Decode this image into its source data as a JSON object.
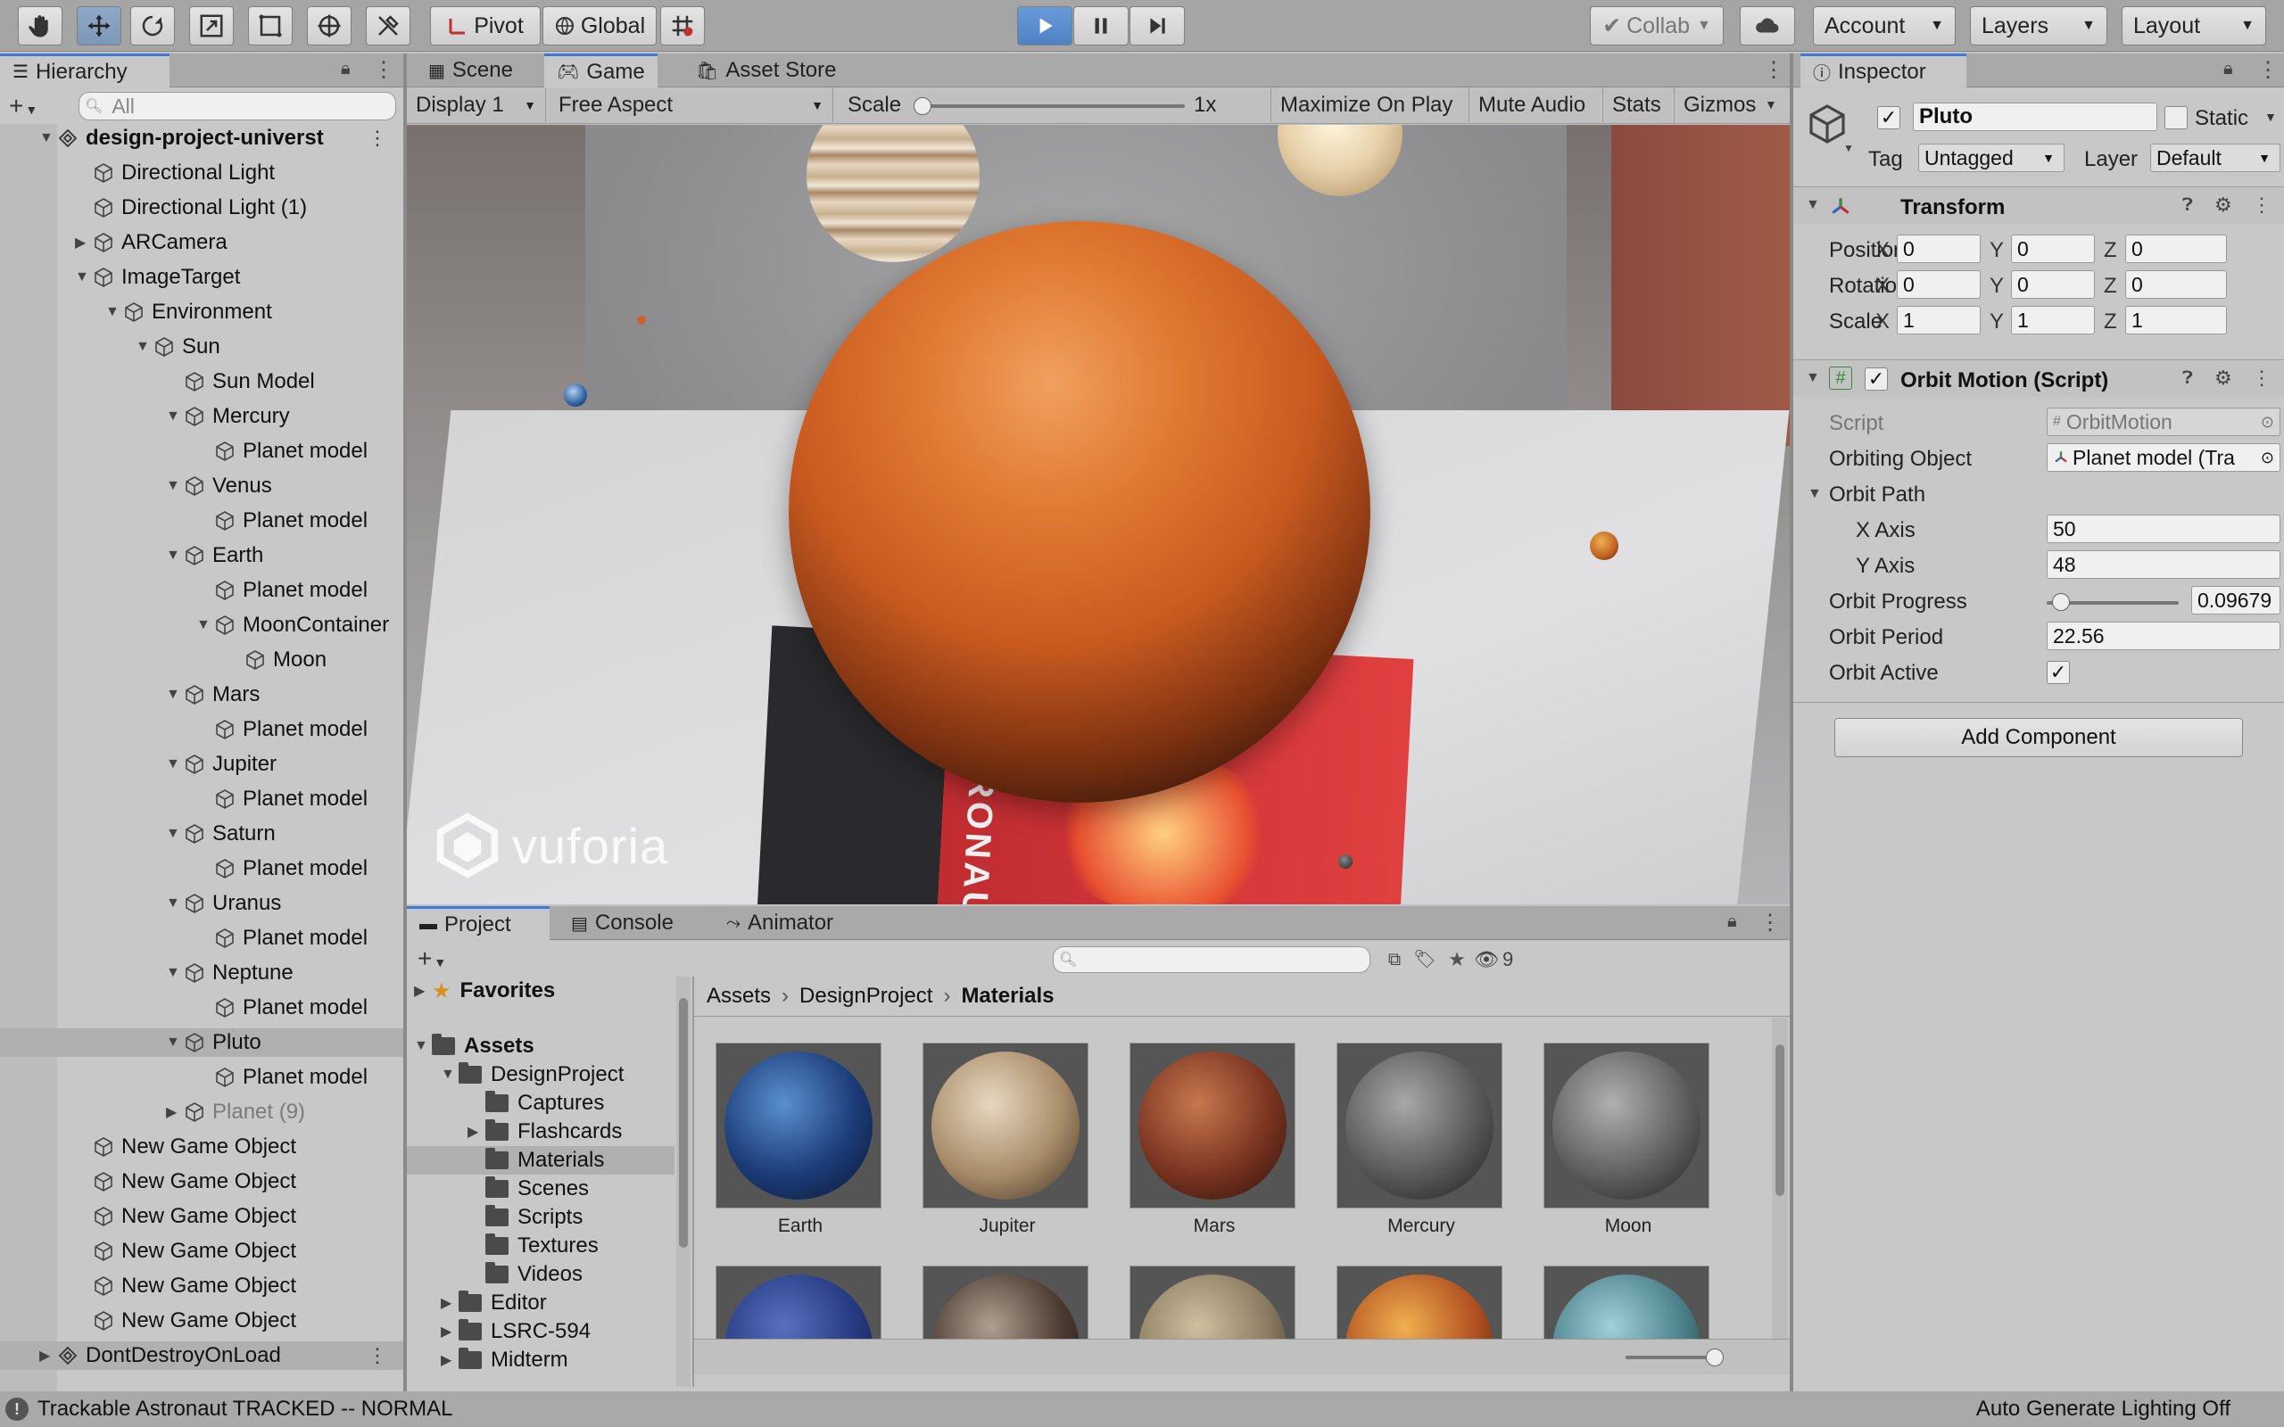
{
  "toolbar": {
    "pivot": "Pivot",
    "global": "Global",
    "collab": "Collab",
    "account": "Account",
    "layers": "Layers",
    "layout": "Layout"
  },
  "hierarchy": {
    "title": "Hierarchy",
    "search_placeholder": "All",
    "rows": [
      {
        "label": "design-project-universt",
        "depth": 0,
        "arrow": "open",
        "icon": "scene-icon",
        "bold": true
      },
      {
        "label": "Directional Light",
        "depth": 1,
        "arrow": "none",
        "icon": "cube-icon"
      },
      {
        "label": "Directional Light (1)",
        "depth": 1,
        "arrow": "none",
        "icon": "cube-icon"
      },
      {
        "label": "ARCamera",
        "depth": 1,
        "arrow": "closed",
        "icon": "cube-icon"
      },
      {
        "label": "ImageTarget",
        "depth": 1,
        "arrow": "open",
        "icon": "cube-icon"
      },
      {
        "label": "Environment",
        "depth": 2,
        "arrow": "open",
        "icon": "cube-icon"
      },
      {
        "label": "Sun",
        "depth": 3,
        "arrow": "open",
        "icon": "cube-icon"
      },
      {
        "label": "Sun Model",
        "depth": 4,
        "arrow": "none",
        "icon": "cube-icon"
      },
      {
        "label": "Mercury",
        "depth": 4,
        "arrow": "open",
        "icon": "cube-icon"
      },
      {
        "label": "Planet model",
        "depth": 5,
        "arrow": "none",
        "icon": "cube-icon"
      },
      {
        "label": "Venus",
        "depth": 4,
        "arrow": "open",
        "icon": "cube-icon"
      },
      {
        "label": "Planet model",
        "depth": 5,
        "arrow": "none",
        "icon": "cube-icon"
      },
      {
        "label": "Earth",
        "depth": 4,
        "arrow": "open",
        "icon": "cube-icon"
      },
      {
        "label": "Planet model",
        "depth": 5,
        "arrow": "none",
        "icon": "cube-icon"
      },
      {
        "label": "MoonContainer",
        "depth": 5,
        "arrow": "open",
        "icon": "cube-icon"
      },
      {
        "label": "Moon",
        "depth": 6,
        "arrow": "none",
        "icon": "cube-icon"
      },
      {
        "label": "Mars",
        "depth": 4,
        "arrow": "open",
        "icon": "cube-icon"
      },
      {
        "label": "Planet model",
        "depth": 5,
        "arrow": "none",
        "icon": "cube-icon"
      },
      {
        "label": "Jupiter",
        "depth": 4,
        "arrow": "open",
        "icon": "cube-icon"
      },
      {
        "label": "Planet model",
        "depth": 5,
        "arrow": "none",
        "icon": "cube-icon"
      },
      {
        "label": "Saturn",
        "depth": 4,
        "arrow": "open",
        "icon": "cube-icon"
      },
      {
        "label": "Planet model",
        "depth": 5,
        "arrow": "none",
        "icon": "cube-icon"
      },
      {
        "label": "Uranus",
        "depth": 4,
        "arrow": "open",
        "icon": "cube-icon"
      },
      {
        "label": "Planet model",
        "depth": 5,
        "arrow": "none",
        "icon": "cube-icon"
      },
      {
        "label": "Neptune",
        "depth": 4,
        "arrow": "open",
        "icon": "cube-icon"
      },
      {
        "label": "Planet model",
        "depth": 5,
        "arrow": "none",
        "icon": "cube-icon"
      },
      {
        "label": "Pluto",
        "depth": 4,
        "arrow": "open",
        "icon": "cube-icon",
        "selected": true
      },
      {
        "label": "Planet model",
        "depth": 5,
        "arrow": "none",
        "icon": "cube-icon"
      },
      {
        "label": "Planet (9)",
        "depth": 4,
        "arrow": "closed",
        "icon": "cube-icon",
        "dim": true
      },
      {
        "label": "New Game Object",
        "depth": 1,
        "arrow": "none",
        "icon": "cube-icon"
      },
      {
        "label": "New Game Object",
        "depth": 1,
        "arrow": "none",
        "icon": "cube-icon"
      },
      {
        "label": "New Game Object",
        "depth": 1,
        "arrow": "none",
        "icon": "cube-icon"
      },
      {
        "label": "New Game Object",
        "depth": 1,
        "arrow": "none",
        "icon": "cube-icon"
      },
      {
        "label": "New Game Object",
        "depth": 1,
        "arrow": "none",
        "icon": "cube-icon"
      },
      {
        "label": "New Game Object",
        "depth": 1,
        "arrow": "none",
        "icon": "cube-icon"
      },
      {
        "label": "DontDestroyOnLoad",
        "depth": 0,
        "arrow": "closed",
        "icon": "scene-icon",
        "selected": true
      }
    ]
  },
  "center_tabs": {
    "scene": "Scene",
    "game": "Game",
    "asset_store": "Asset Store"
  },
  "game_bar": {
    "display": "Display 1",
    "aspect": "Free Aspect",
    "scale_label": "Scale",
    "scale_value": "1x",
    "maximize": "Maximize On Play",
    "mute": "Mute Audio",
    "stats": "Stats",
    "gizmos": "Gizmos"
  },
  "game_view": {
    "watermark": "vuforia",
    "card_text": "ASTRONAUT"
  },
  "inspector": {
    "title": "Inspector",
    "object_name": "Pluto",
    "static_label": "Static",
    "tag_label": "Tag",
    "tag_value": "Untagged",
    "layer_label": "Layer",
    "layer_value": "Default",
    "transform": {
      "title": "Transform",
      "rows": [
        {
          "label": "Position",
          "x": "0",
          "y": "0",
          "z": "0"
        },
        {
          "label": "Rotation",
          "x": "0",
          "y": "0",
          "z": "0"
        },
        {
          "label": "Scale",
          "x": "1",
          "y": "1",
          "z": "1"
        }
      ]
    },
    "orbit": {
      "title": "Orbit Motion (Script)",
      "script_label": "Script",
      "script_value": "OrbitMotion",
      "orbiting_label": "Orbiting Object",
      "orbiting_value": "Planet model (Tra",
      "path_label": "Orbit Path",
      "x_axis_label": "X Axis",
      "x_axis_value": "50",
      "y_axis_label": "Y Axis",
      "y_axis_value": "48",
      "progress_label": "Orbit Progress",
      "progress_value": "0.09679",
      "period_label": "Orbit Period",
      "period_value": "22.56",
      "active_label": "Orbit Active"
    },
    "add_component": "Add Component"
  },
  "bottom_tabs": {
    "project": "Project",
    "console": "Console",
    "animator": "Animator"
  },
  "project": {
    "hidden_count": "9",
    "tree": [
      {
        "label": "Favorites",
        "depth": 0,
        "arrow": "closed",
        "icon": "star-icon",
        "bold": true
      },
      {
        "label": "Assets",
        "depth": 0,
        "arrow": "open",
        "icon": "folder-icon",
        "bold": true
      },
      {
        "label": "DesignProject",
        "depth": 1,
        "arrow": "open",
        "icon": "folder-icon"
      },
      {
        "label": "Captures",
        "depth": 2,
        "arrow": "none",
        "icon": "folder-icon"
      },
      {
        "label": "Flashcards",
        "depth": 2,
        "arrow": "closed",
        "icon": "folder-icon"
      },
      {
        "label": "Materials",
        "depth": 2,
        "arrow": "none",
        "icon": "folder-icon",
        "selected": true
      },
      {
        "label": "Scenes",
        "depth": 2,
        "arrow": "none",
        "icon": "folder-icon"
      },
      {
        "label": "Scripts",
        "depth": 2,
        "arrow": "none",
        "icon": "folder-icon"
      },
      {
        "label": "Textures",
        "depth": 2,
        "arrow": "none",
        "icon": "folder-icon"
      },
      {
        "label": "Videos",
        "depth": 2,
        "arrow": "none",
        "icon": "folder-icon"
      },
      {
        "label": "Editor",
        "depth": 1,
        "arrow": "closed",
        "icon": "folder-icon"
      },
      {
        "label": "LSRC-594",
        "depth": 1,
        "arrow": "closed",
        "icon": "folder-icon"
      },
      {
        "label": "Midterm",
        "depth": 1,
        "arrow": "closed",
        "icon": "folder-icon"
      }
    ],
    "breadcrumb": [
      "Assets",
      "DesignProject",
      "Materials"
    ],
    "assets": [
      {
        "name": "Earth",
        "gradient": "radial-gradient(circle at 40% 35%,#5a8fd0,#1c3c78 55%,#0b1530)"
      },
      {
        "name": "Jupiter",
        "gradient": "radial-gradient(circle at 40% 35%,#e8d8c0,#a88c6a 55%,#3e3022)"
      },
      {
        "name": "Mars",
        "gradient": "radial-gradient(circle at 40% 35%,#c87850,#7a3420 55%,#2a100a)"
      },
      {
        "name": "Mercury",
        "gradient": "radial-gradient(circle at 40% 35%,#a8a8a8,#5a5a5a 55%,#1c1c1c)"
      },
      {
        "name": "Moon",
        "gradient": "radial-gradient(circle at 40% 35%,#b0b0b0,#606060 55%,#202020)"
      },
      {
        "name": "",
        "gradient": "radial-gradient(circle at 40% 35%,#5a70c0,#253a80 55%,#0c1230)"
      },
      {
        "name": "",
        "gradient": "radial-gradient(circle at 40% 35%,#b0a090,#4a3a30 55%,#181010)"
      },
      {
        "name": "",
        "gradient": "radial-gradient(circle at 40% 35%,#d0c0a0,#8a7a60 55%,#2a2418)"
      },
      {
        "name": "",
        "gradient": "radial-gradient(circle at 40% 35%,#f0b050,#b05020 55%,#3a1808)"
      },
      {
        "name": "",
        "gradient": "radial-gradient(circle at 40% 35%,#a0d0d8,#4a8088 55%,#183034)"
      }
    ]
  },
  "status": {
    "message": "Trackable Astronaut TRACKED -- NORMAL",
    "lighting": "Auto Generate Lighting Off"
  }
}
